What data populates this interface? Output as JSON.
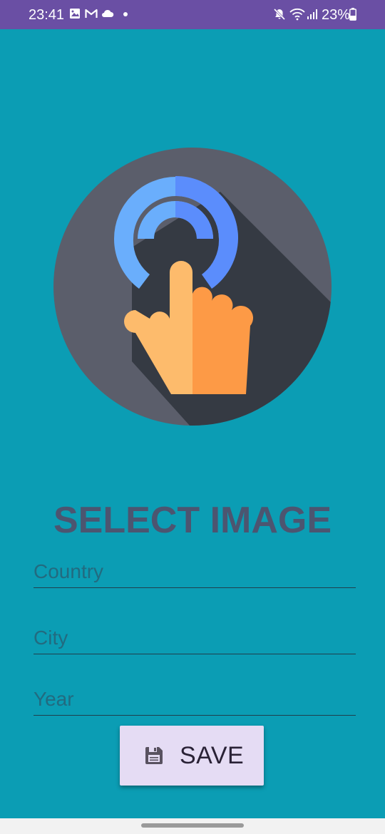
{
  "status_bar": {
    "time": "23:41",
    "battery": "23%",
    "notification_icons": [
      "gallery-icon",
      "gmail-icon",
      "cloud-icon",
      "dot-icon"
    ],
    "system_icons": [
      "mute-icon",
      "wifi-icon",
      "signal-icon",
      "battery-icon"
    ]
  },
  "hero": {
    "icon": "tap-touch-icon"
  },
  "title": "SELECT IMAGE",
  "form": {
    "country_placeholder": "Country",
    "city_placeholder": "City",
    "year_placeholder": "Year"
  },
  "save_button": {
    "label": "SAVE",
    "icon": "save-icon"
  },
  "colors": {
    "background": "#0b9db4",
    "status_bar": "#6a4fa4",
    "title": "#4c5570",
    "button_bg": "#e5dcf4"
  }
}
